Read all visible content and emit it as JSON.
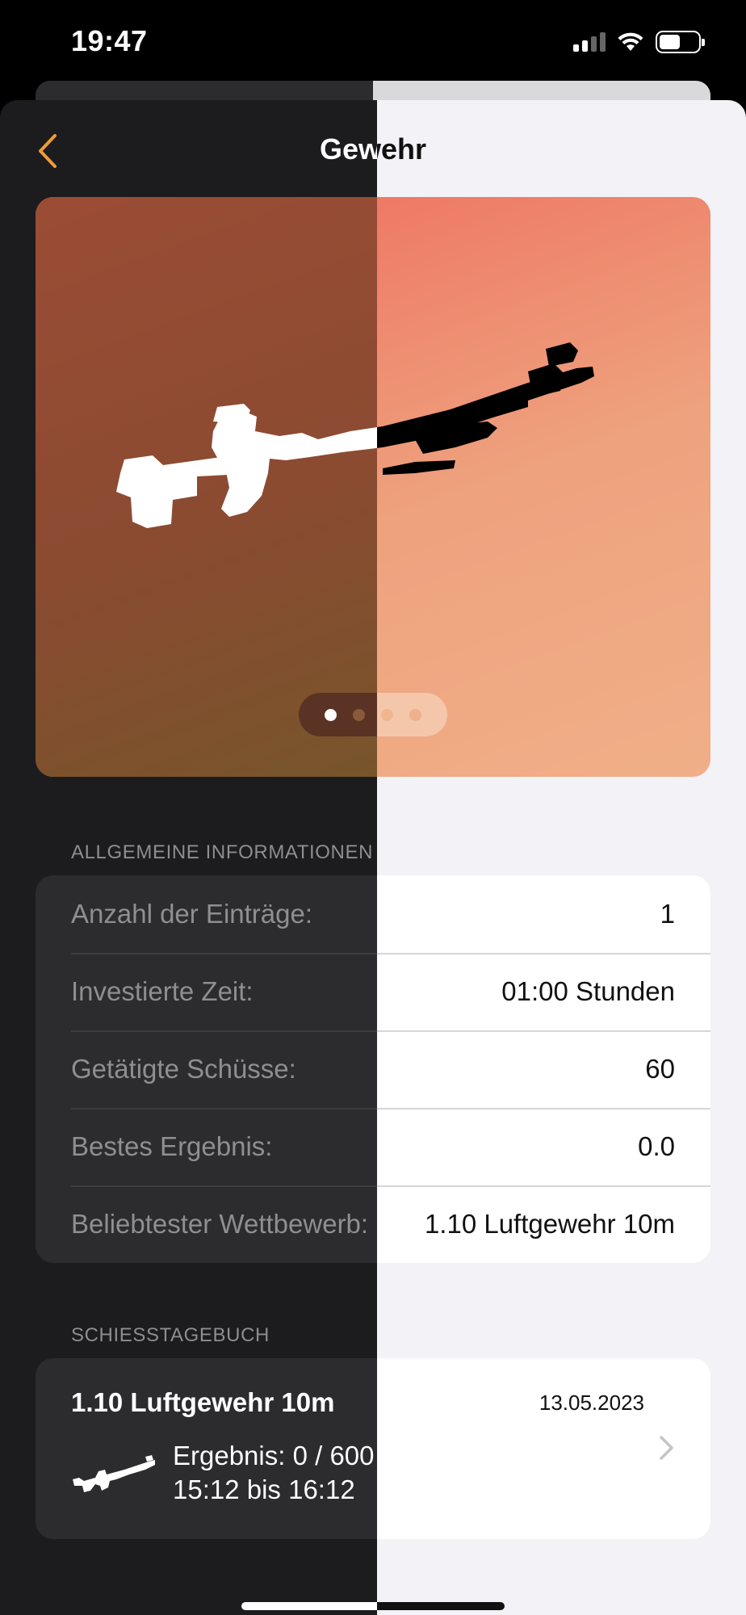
{
  "status_bar": {
    "time": "19:47"
  },
  "nav": {
    "title": "Gewehr",
    "back_icon": "chevron-left-icon",
    "accent": "#f09a37"
  },
  "hero": {
    "image": "air-rifle",
    "page_count": 4,
    "current_page": 1
  },
  "general": {
    "section_label": "ALLGEMEINE INFORMATIONEN",
    "rows": [
      {
        "label": "Anzahl der Einträge:",
        "value": "1"
      },
      {
        "label": "Investierte Zeit:",
        "value": "01:00 Stunden"
      },
      {
        "label": "Getätigte Schüsse:",
        "value": "60"
      },
      {
        "label": "Bestes Ergebnis:",
        "value": "0.0"
      },
      {
        "label": "Beliebtester Wettbewerb:",
        "value": "1.10 Luftgewehr 10m"
      }
    ]
  },
  "journal": {
    "section_label": "SCHIESSTAGEBUCH",
    "entry": {
      "title": "1.10 Luftgewehr 10m",
      "date": "13.05.2023",
      "result": "Ergebnis: 0 / 600",
      "time_range": "15:12 bis 16:12",
      "icon": "rifle-icon"
    }
  }
}
